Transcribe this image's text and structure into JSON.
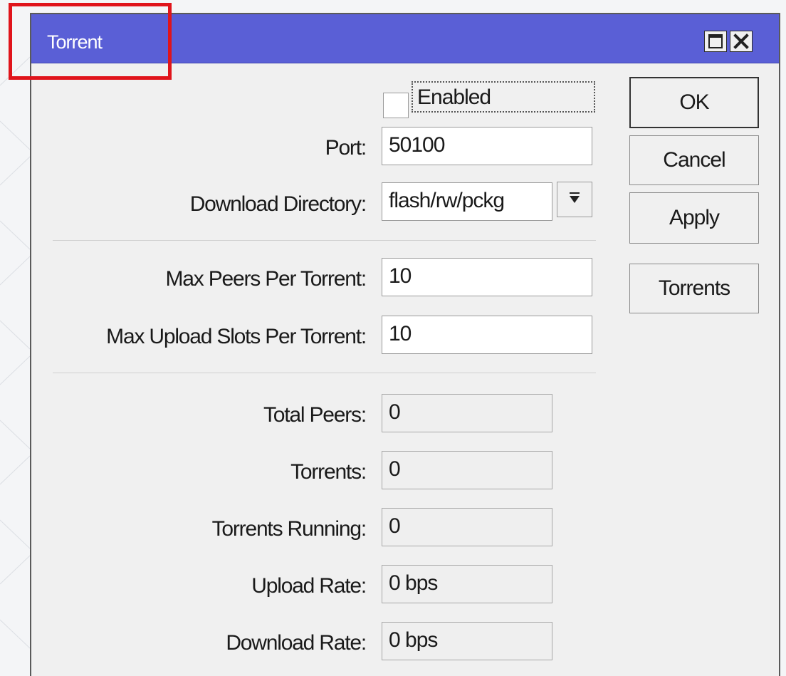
{
  "window": {
    "title": "Torrent",
    "title_bar_color": "#5a5fd6",
    "highlight_color": "#e0141b",
    "controls": [
      "maximize-icon",
      "close-icon"
    ]
  },
  "enabled": {
    "label": "Enabled",
    "checked": false
  },
  "settings": {
    "port": {
      "label": "Port:",
      "value": "50100"
    },
    "download_directory": {
      "label": "Download Directory:",
      "value": "flash/rw/pckg"
    },
    "max_peers": {
      "label": "Max Peers Per Torrent:",
      "value": "10"
    },
    "max_upload_slots": {
      "label": "Max Upload Slots Per Torrent:",
      "value": "10"
    }
  },
  "status": {
    "total_peers": {
      "label": "Total Peers:",
      "value": "0"
    },
    "torrents": {
      "label": "Torrents:",
      "value": "0"
    },
    "torrents_running": {
      "label": "Torrents Running:",
      "value": "0"
    },
    "upload_rate": {
      "label": "Upload Rate:",
      "value": "0 bps"
    },
    "download_rate": {
      "label": "Download Rate:",
      "value": "0 bps"
    }
  },
  "buttons": {
    "ok": "OK",
    "cancel": "Cancel",
    "apply": "Apply",
    "torrents": "Torrents"
  }
}
